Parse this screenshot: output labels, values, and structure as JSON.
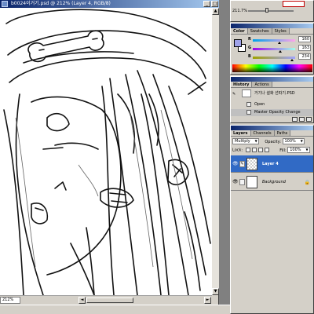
{
  "document": {
    "title": "b0024이거기.psd @ 212% (Layer 4, RGB/8)",
    "zoom": "212%"
  },
  "navigator": {
    "zoom": "211.7%"
  },
  "color": {
    "tabs": [
      "Color",
      "Swatches",
      "Styles"
    ],
    "foreground": "#a0a3ea",
    "rgb": [
      {
        "label": "R",
        "value": "160",
        "fraction": 0.627
      },
      {
        "label": "G",
        "value": "163",
        "fraction": 0.639
      },
      {
        "label": "B",
        "value": "234",
        "fraction": 0.918
      }
    ]
  },
  "history": {
    "tabs": [
      "History",
      "Actions"
    ],
    "file": "거기나 설화 선따기.PSD",
    "items": [
      "Open",
      "Master Opacity Change"
    ]
  },
  "layers": {
    "tabs": [
      "Layers",
      "Channels",
      "Paths"
    ],
    "blend_mode": "Multiply",
    "opacity_label": "Opacity:",
    "opacity": "100%",
    "lock_label": "Lock:",
    "fill_label": "Fill:",
    "fill": "100%",
    "items": [
      {
        "name": "Layer 4",
        "active": true
      },
      {
        "name": "Background",
        "active": false
      }
    ]
  }
}
